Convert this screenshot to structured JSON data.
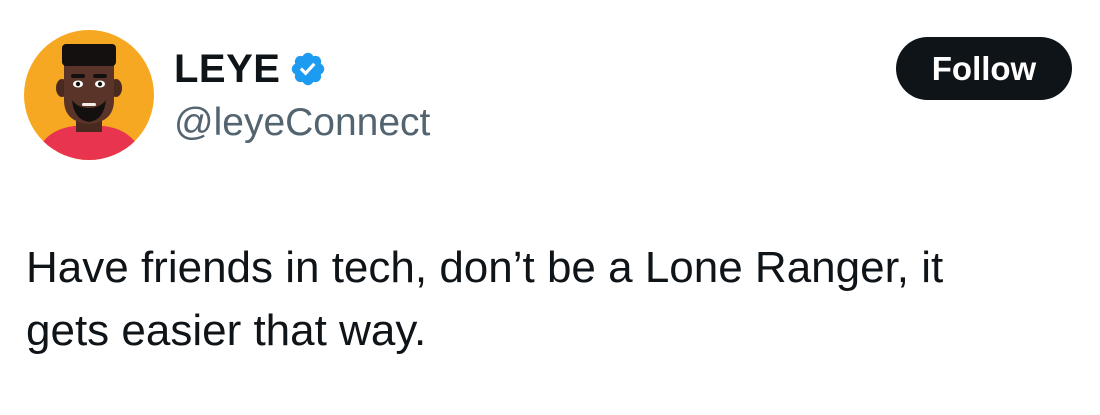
{
  "tweet": {
    "author": {
      "display_name": "LEYE",
      "handle": "@leyeConnect",
      "verified": true,
      "avatar_icon": "cartoon-man-avatar"
    },
    "follow_label": "Follow",
    "text_line_1": "Have friends in tech, don’t be a Lone Ranger, it",
    "text_line_2": "gets easier that way."
  },
  "colors": {
    "text_primary": "#0f1419",
    "text_secondary": "#536471",
    "verified_blue": "#1d9bf0",
    "follow_button_bg": "#0f1419",
    "avatar_bg": "#f7a823",
    "avatar_shirt": "#e8344e"
  }
}
